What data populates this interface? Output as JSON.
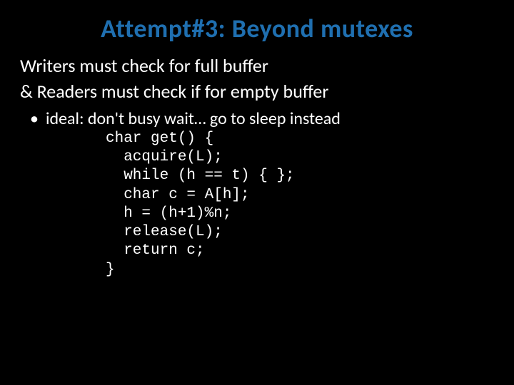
{
  "title": "Attempt#3: Beyond mutexes",
  "body": {
    "line1": "Writers must check for full buffer",
    "line2": "& Readers must check if for empty buffer"
  },
  "bullet1": "ideal: don't busy wait… go to sleep instead",
  "code": {
    "l1": "char get() {",
    "l2": "  acquire(L);",
    "l3": "  while (h == t) { };",
    "l4": "  char c = A[h];",
    "l5": "  h = (h+1)%n;",
    "l6": "  release(L);",
    "l7": "  return c;",
    "l8": "}"
  }
}
